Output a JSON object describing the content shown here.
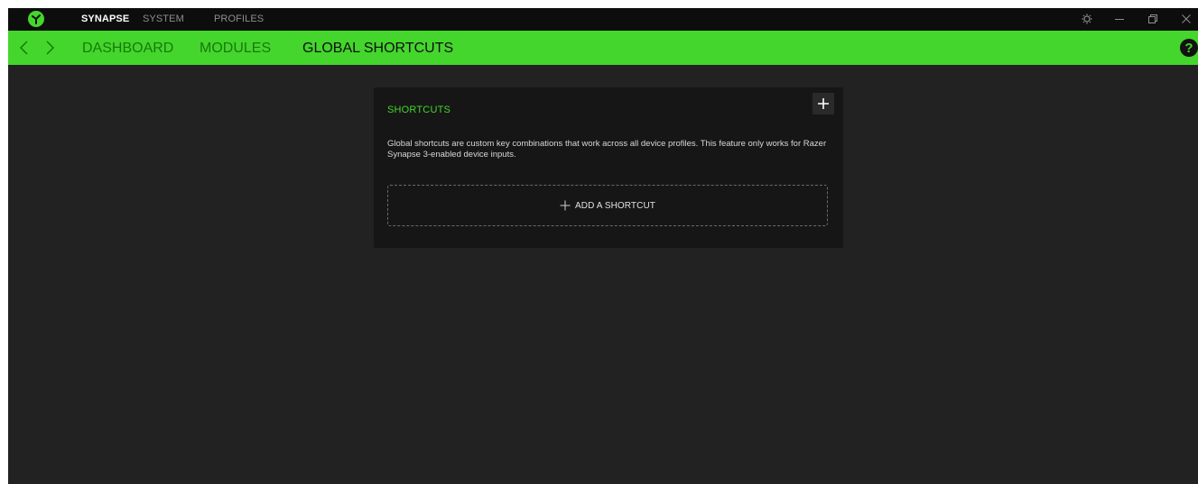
{
  "titlebar": {
    "tabs": [
      {
        "label": "SYNAPSE",
        "active": true
      },
      {
        "label": "SYSTEM",
        "active": false
      },
      {
        "label": "PROFILES",
        "active": false
      }
    ],
    "icons": [
      "razer-logo-icon",
      "settings-icon",
      "minimize-icon",
      "restore-icon",
      "close-icon"
    ]
  },
  "navbar": {
    "tabs": [
      {
        "label": "DASHBOARD",
        "active": false
      },
      {
        "label": "MODULES",
        "active": false
      },
      {
        "label": "GLOBAL SHORTCUTS",
        "active": true
      }
    ],
    "help_label": "?",
    "icons": [
      "back-arrow-icon",
      "forward-arrow-icon"
    ]
  },
  "card": {
    "title": "SHORTCUTS",
    "description": "Global shortcuts are custom key combinations that work across all device profiles. This feature only works for Razer Synapse 3-enabled device inputs.",
    "add_shortcut_label": "ADD A SHORTCUT",
    "icons": [
      "plus-icon"
    ]
  },
  "colors": {
    "accent": "#44d62c",
    "background": "#222222",
    "titlebar": "#0d0d0d",
    "card": "#161616"
  }
}
